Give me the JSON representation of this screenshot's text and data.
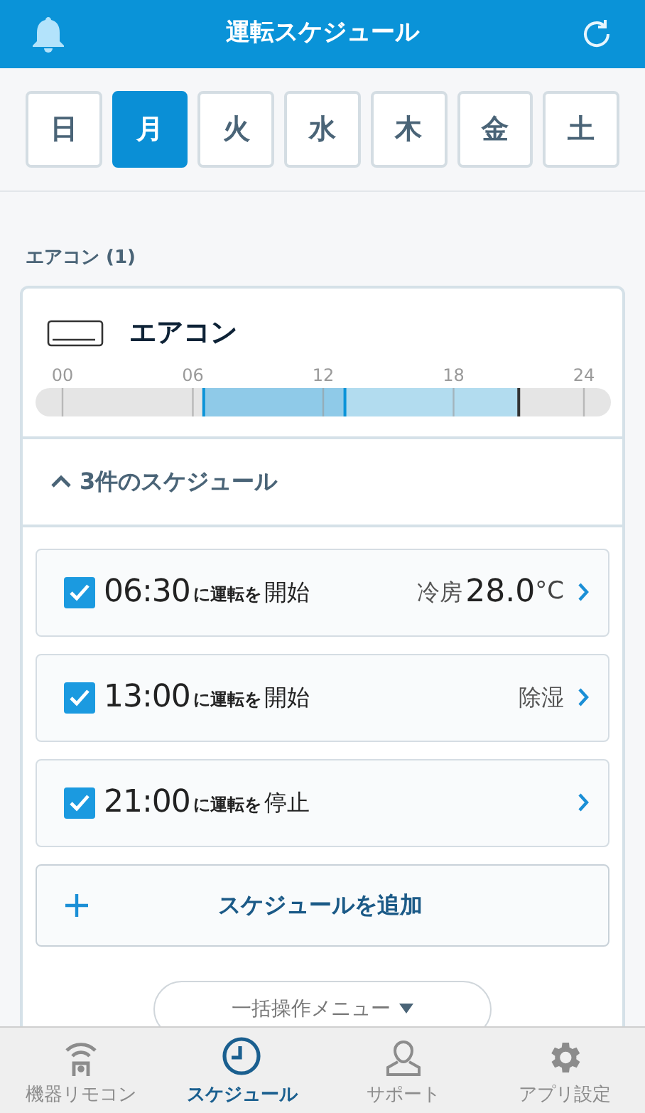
{
  "header": {
    "title": "運転スケジュール"
  },
  "days": [
    {
      "label": "日",
      "selected": false
    },
    {
      "label": "月",
      "selected": true
    },
    {
      "label": "火",
      "selected": false
    },
    {
      "label": "水",
      "selected": false
    },
    {
      "label": "木",
      "selected": false
    },
    {
      "label": "金",
      "selected": false
    },
    {
      "label": "土",
      "selected": false
    }
  ],
  "section_label": "エアコン (1)",
  "device": {
    "name": "エアコン",
    "timeline": {
      "ticks": [
        "00",
        "06",
        "12",
        "18",
        "24"
      ]
    },
    "collapse": {
      "label": "3件のスケジュール",
      "expanded": true
    },
    "schedules": [
      {
        "time": "06:30",
        "connector": "に運転を",
        "action": "開始",
        "kind": "start",
        "checked": true,
        "mode": "冷房",
        "temperature": "28.0",
        "unit": "°C",
        "color": "#8fcae8"
      },
      {
        "time": "13:00",
        "connector": "に運転を",
        "action": "開始",
        "kind": "start",
        "checked": true,
        "mode": "除湿",
        "color": "#b2dcef"
      },
      {
        "time": "21:00",
        "connector": "に運転を",
        "action": "停止",
        "kind": "stop",
        "checked": true
      }
    ],
    "add_button": "スケジュールを追加"
  },
  "bulk_menu": "一括操作メニュー",
  "tabs": [
    {
      "label": "機器リモコン",
      "selected": false
    },
    {
      "label": "スケジュール",
      "selected": true
    },
    {
      "label": "サポート",
      "selected": false
    },
    {
      "label": "アプリ設定",
      "selected": false
    }
  ]
}
